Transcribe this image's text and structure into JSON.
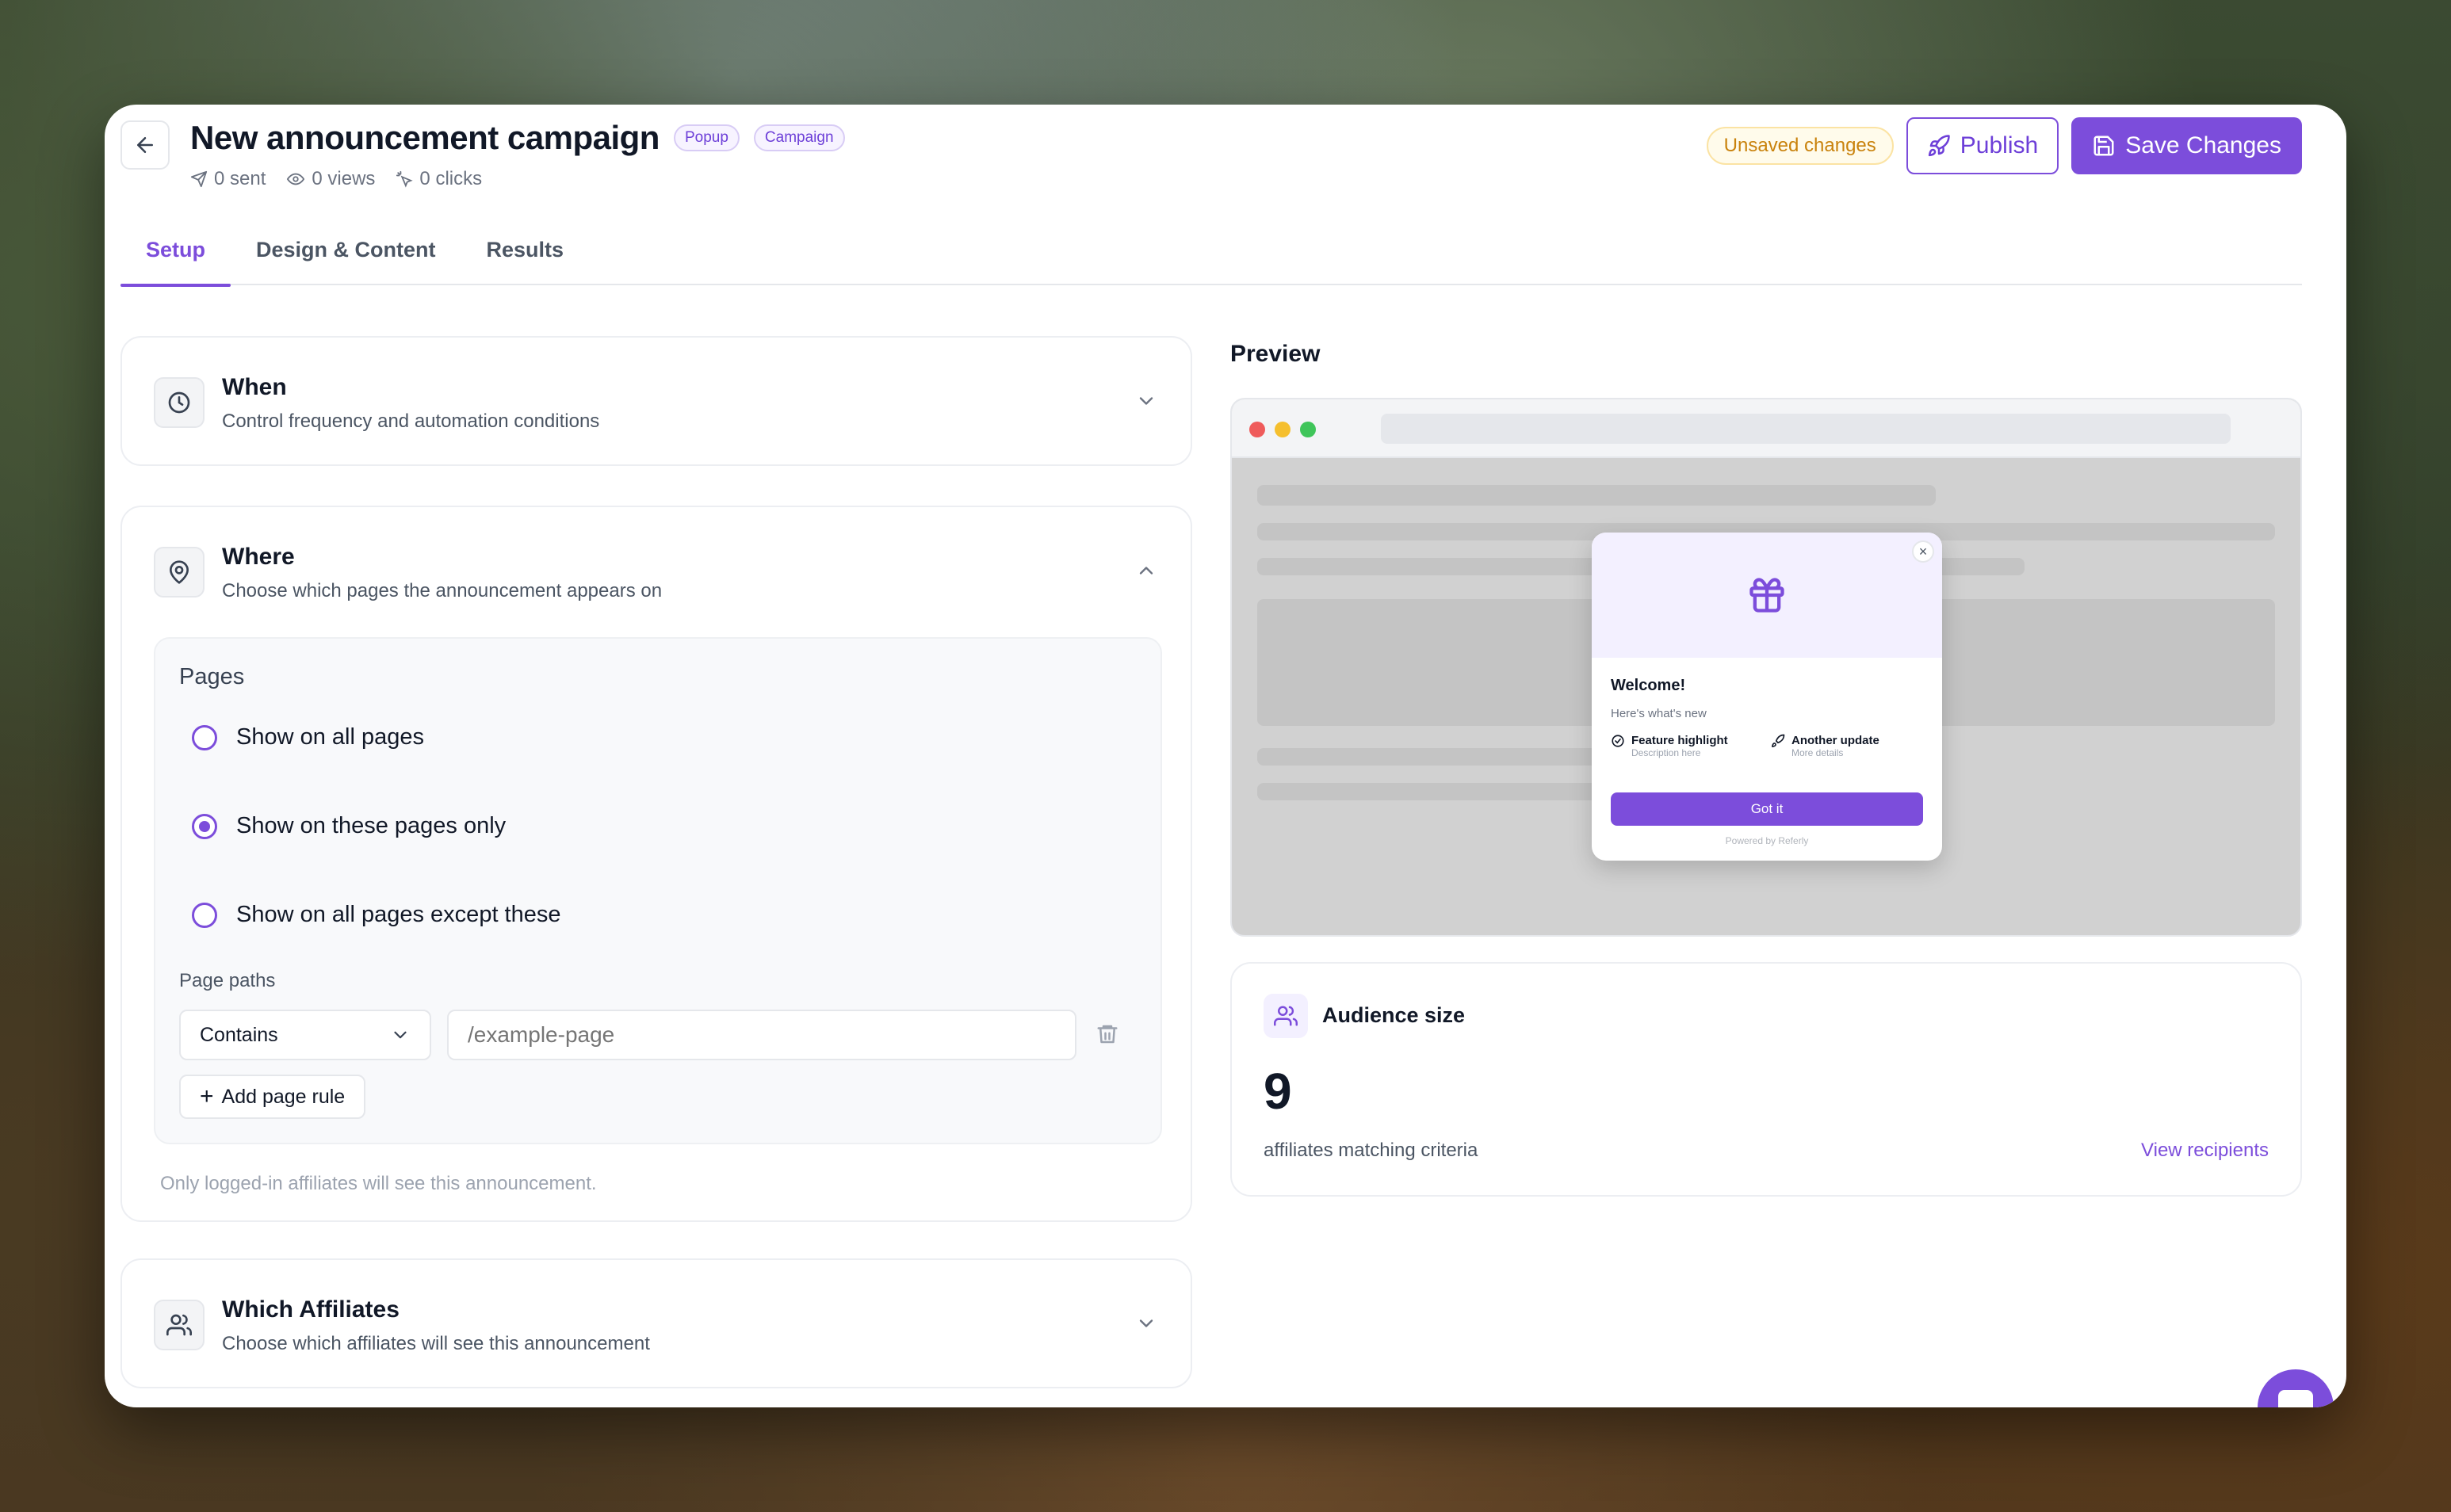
{
  "header": {
    "title": "New announcement campaign",
    "tags": [
      "Popup",
      "Campaign"
    ],
    "stats": {
      "sent": "0 sent",
      "views": "0 views",
      "clicks": "0 clicks"
    },
    "unsaved_label": "Unsaved changes",
    "publish_label": "Publish",
    "save_label": "Save Changes"
  },
  "tabs": [
    {
      "label": "Setup",
      "active": true
    },
    {
      "label": "Design & Content",
      "active": false
    },
    {
      "label": "Results",
      "active": false
    }
  ],
  "sections": {
    "when": {
      "title": "When",
      "subtitle": "Control frequency and automation conditions",
      "icon": "clock-icon"
    },
    "where": {
      "title": "Where",
      "subtitle": "Choose which pages the announcement appears on",
      "icon": "map-pin-icon",
      "pages_label": "Pages",
      "options": [
        {
          "label": "Show on all pages",
          "checked": false
        },
        {
          "label": "Show on these pages only",
          "checked": true
        },
        {
          "label": "Show on all pages except these",
          "checked": false
        }
      ],
      "paths_label": "Page paths",
      "match_type": "Contains",
      "path_placeholder": "/example-page",
      "add_rule_label": "Add page rule",
      "note": "Only logged-in affiliates will see this announcement."
    },
    "affiliates": {
      "title": "Which Affiliates",
      "subtitle": "Choose which affiliates will see this announcement",
      "icon": "users-icon"
    }
  },
  "preview": {
    "title": "Preview",
    "popup": {
      "title": "Welcome!",
      "subtitle": "Here's what's new",
      "features": [
        {
          "title": "Feature highlight",
          "desc": "Description here",
          "icon": "check-circle-icon"
        },
        {
          "title": "Another update",
          "desc": "More details",
          "icon": "rocket-icon"
        }
      ],
      "button_label": "Got it",
      "powered": "Powered by Referly"
    }
  },
  "audience": {
    "title": "Audience size",
    "count": "9",
    "label": "affiliates matching criteria",
    "link": "View recipients"
  },
  "colors": {
    "accent": "#7c4ddb",
    "warning": "#c9820c"
  }
}
